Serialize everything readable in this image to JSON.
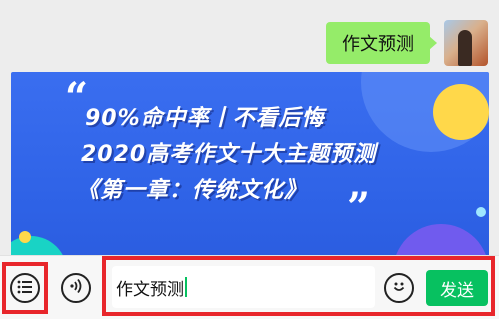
{
  "message": {
    "text": "作文预测"
  },
  "poster": {
    "line1": "90%命中率丨不看后悔",
    "line2": "2020高考作文十大主题预测",
    "line3": "《第一章：传统文化》",
    "open_quote": "“",
    "close_quote": "”"
  },
  "input_bar": {
    "input_value": "作文预测",
    "send_label": "发送"
  },
  "colors": {
    "bubble": "#95ec69",
    "send_button": "#07c160",
    "highlight": "#e8262b",
    "poster_bg": "#3a6ef0"
  },
  "icons": [
    "menu-list-icon",
    "voice-icon",
    "emoji-icon"
  ]
}
